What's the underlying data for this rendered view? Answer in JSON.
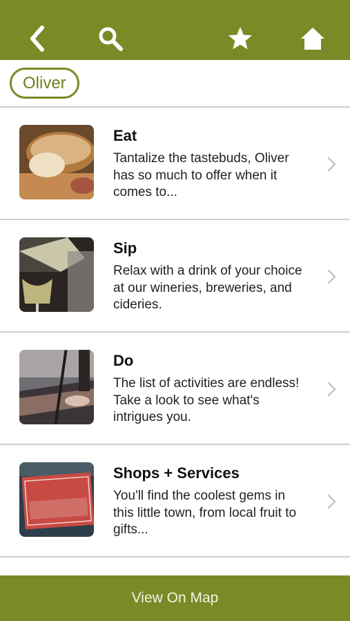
{
  "colors": {
    "brand": "#7b8a26",
    "chip_text": "#6f7f1e",
    "divider": "#cfcfcf"
  },
  "header": {
    "icons": [
      "chevron-left-icon",
      "search-icon",
      "star-icon",
      "home-icon"
    ]
  },
  "filter": {
    "chip_label": "Oliver"
  },
  "items": [
    {
      "title": "Eat",
      "description": "Tantalize the tastebuds, Oliver has so much to offer when it comes to...",
      "image": "bread"
    },
    {
      "title": "Sip",
      "description": "Relax with a drink of your choice at our wineries, breweries, and cideries.",
      "image": "wine"
    },
    {
      "title": "Do",
      "description": "The list of activities are endless! Take a look to see what's intrigues you.",
      "image": "paddleboard"
    },
    {
      "title": "Shops + Services",
      "description": "You'll find the coolest gems in this little town, from local fruit to gifts...",
      "image": "open-sign"
    }
  ],
  "footer": {
    "map_button_label": "View On Map"
  }
}
